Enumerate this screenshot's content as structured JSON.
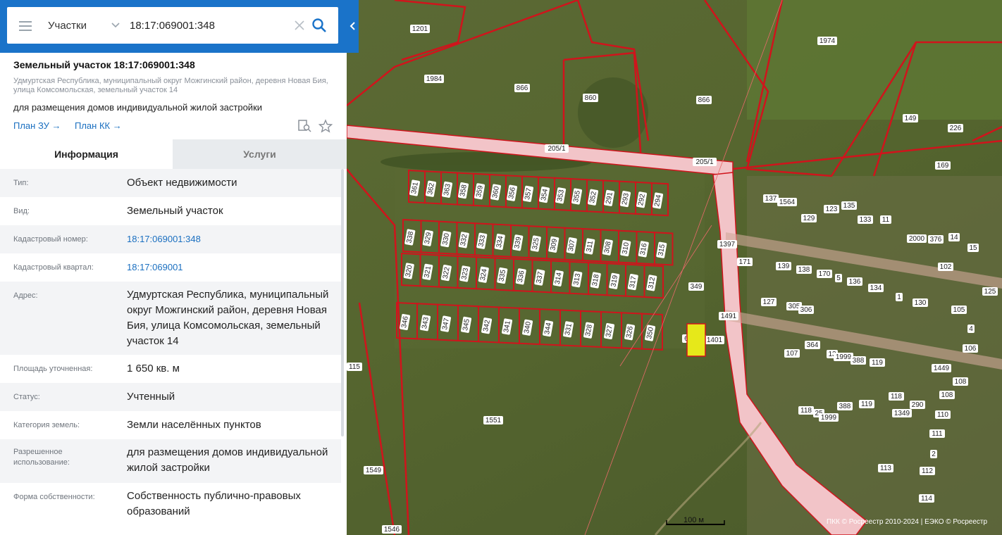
{
  "search": {
    "layer_select": "Участки",
    "query": "18:17:069001:348",
    "icons": {
      "menu": "menu-icon",
      "dropdown": "chevron-down-icon",
      "clear": "close-icon",
      "search": "search-icon",
      "collapse": "chevron-left-icon"
    }
  },
  "card": {
    "title": "Земельный участок 18:17:069001:348",
    "address": "Удмуртская Республика, муниципальный округ Можгинский район, деревня Новая Бия, улица Комсомольская, земельный участок 14",
    "purpose": "для размещения домов индивидуальной жилой застройки",
    "links": [
      "План ЗУ →",
      "План КК →"
    ],
    "tools": [
      "search-document-icon",
      "star-icon"
    ]
  },
  "tabs": [
    "Информация",
    "Услуги"
  ],
  "info_rows": [
    {
      "key": "Тип:",
      "value": "Объект недвижимости"
    },
    {
      "key": "Вид:",
      "value": "Земельный участок"
    },
    {
      "key": "Кадастровый номер:",
      "value": "18:17:069001:348"
    },
    {
      "key": "Кадастровый квартал:",
      "value": "18:17:069001"
    },
    {
      "key": "Адрес:",
      "value": "Удмуртская Республика, муниципальный округ Можгинский район, деревня Новая Бия, улица Комсомольская, земельный участок 14"
    },
    {
      "key": "Площадь уточненная:",
      "value": "1 650 кв. м"
    },
    {
      "key": "Статус:",
      "value": "Учтенный"
    },
    {
      "key": "Категория земель:",
      "value": "Земли населённых пунктов"
    },
    {
      "key": "Разрешенное использование:",
      "value": "для размещения домов индивидуальной жилой застройки"
    },
    {
      "key": "Форма собственности:",
      "value": "Собственность публично-правовых образований"
    }
  ],
  "map": {
    "scale_label": "100 м",
    "attribution": "ПКК © Росреестр 2010-2024 | ЕЭКО © Росреестр",
    "colors": {
      "parcel_border": "#d0141c",
      "road_fill": "#f2c4c8",
      "selected": "#e6e81a"
    },
    "parcel_labels": {
      "row1": [
        "361",
        "362",
        "363",
        "358",
        "359",
        "360",
        "356",
        "357",
        "354",
        "353",
        "355",
        "352",
        "291",
        "293",
        "292",
        "294"
      ],
      "row2": [
        "338",
        "329",
        "330",
        "332",
        "333",
        "334",
        "339",
        "325",
        "309",
        "307",
        "311",
        "308",
        "310",
        "316",
        "315"
      ],
      "row3": [
        "320",
        "321",
        "322",
        "323",
        "324",
        "335",
        "336",
        "337",
        "314",
        "313",
        "318",
        "319",
        "317",
        "312"
      ],
      "row4": [
        "346",
        "343",
        "347",
        "345",
        "342",
        "341",
        "340",
        "344",
        "331",
        "328",
        "327",
        "326",
        "350"
      ],
      "misc": [
        "1201",
        "1974",
        "1984",
        "866",
        "860",
        "866",
        "149",
        "226",
        "169",
        "205/1",
        "205/1",
        "1397",
        "1491",
        "349",
        "1401",
        "69001",
        "171",
        "139",
        "138",
        "170",
        "5",
        "136",
        "134",
        "1",
        "130",
        "127",
        "305",
        "306",
        "123",
        "135",
        "133",
        "11",
        "129",
        "137",
        "1564",
        "2000",
        "376",
        "14",
        "15",
        "102",
        "125",
        "105",
        "4",
        "106",
        "107",
        "364",
        "13",
        "1999",
        "388",
        "119",
        "118",
        "25",
        "1999",
        "388",
        "119",
        "118",
        "290",
        "1349",
        "1449",
        "108",
        "108",
        "110",
        "111",
        "2",
        "112",
        "113",
        "114",
        "115",
        "1549",
        "1546",
        "1551"
      ]
    }
  }
}
